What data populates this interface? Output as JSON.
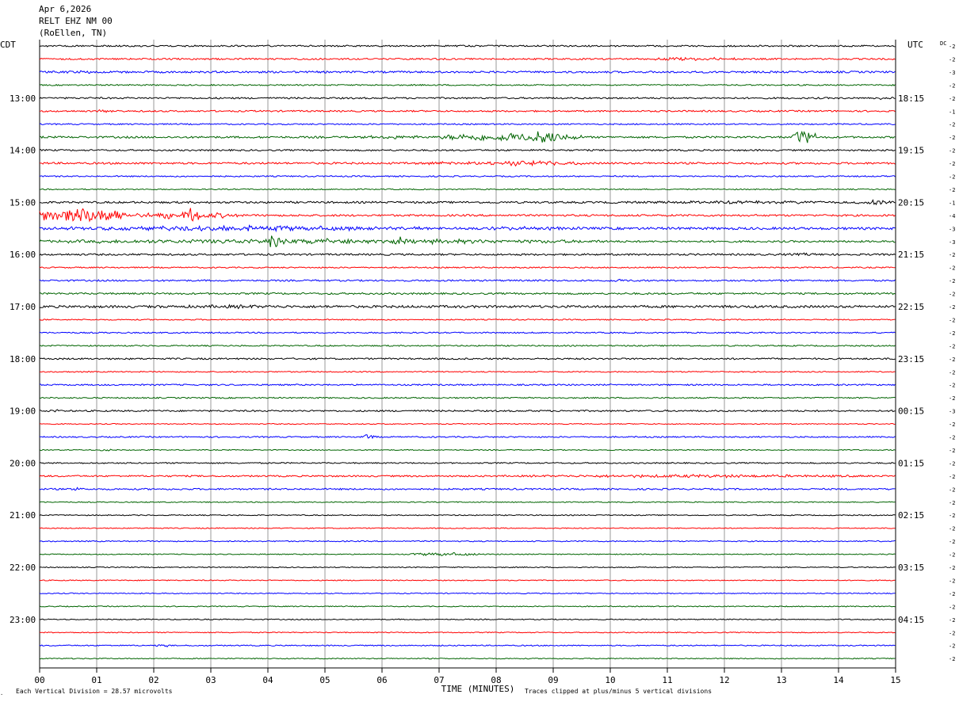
{
  "header": {
    "date": "Apr 6,2026",
    "station": "RELT EHZ NM 00",
    "location": "(RoEllen, TN)"
  },
  "left_zone": "CDT",
  "right_zone": "UTC",
  "dc_label": "DC",
  "footer": {
    "vertical_division": "Each Vertical Division =   28.57 microvolts",
    "clip_note": "Traces clipped at plus/minus 5 vertical divisions"
  },
  "chart_data": {
    "type": "line",
    "title": "",
    "xlabel": "TIME (MINUTES)",
    "ylabel": "",
    "xlim": [
      0,
      15
    ],
    "x_ticks": [
      "00",
      "01",
      "02",
      "03",
      "04",
      "05",
      "06",
      "07",
      "08",
      "09",
      "10",
      "11",
      "12",
      "13",
      "14",
      "15"
    ],
    "grid": true,
    "trace_colors": [
      "#000000",
      "#ff0000",
      "#0000ff",
      "#006400"
    ],
    "left_hour_labels": [
      "13:00",
      "14:00",
      "15:00",
      "16:00",
      "17:00",
      "18:00",
      "19:00",
      "20:00",
      "21:00",
      "22:00",
      "23:00"
    ],
    "right_hour_labels": [
      "18:15",
      "19:15",
      "20:15",
      "21:15",
      "22:15",
      "23:15",
      "00:15",
      "01:15",
      "02:15",
      "03:15",
      "04:15"
    ],
    "dc_offsets": [
      "-2",
      "-2",
      "-3",
      "-2",
      "-2",
      "-1",
      "-2",
      "-2",
      "-2",
      "-2",
      "-2",
      "-2",
      "-1",
      "-4",
      "-3",
      "-3",
      "-2",
      "-2",
      "-2",
      "-2",
      "-2",
      "-2",
      "-2",
      "-2",
      "-2",
      "-2",
      "-2",
      "-2",
      "-3",
      "-2",
      "-2",
      "-2",
      "-2",
      "-2",
      "-2",
      "-2",
      "-2",
      "-2",
      "-2",
      "-2",
      "-2",
      "-2",
      "-2",
      "-2",
      "-2",
      "-2",
      "-2",
      "-2"
    ],
    "traces": [
      {
        "amp": 1.0,
        "events": []
      },
      {
        "amp": 1.0,
        "events": [
          [
            10.5,
            12.5,
            1.8
          ]
        ]
      },
      {
        "amp": 1.2,
        "events": [
          [
            0,
            1.5,
            1.6
          ]
        ]
      },
      {
        "amp": 0.8,
        "events": []
      },
      {
        "amp": 1.0,
        "events": [
          [
            14.5,
            15,
            1.8
          ]
        ]
      },
      {
        "amp": 1.0,
        "events": [
          [
            0.9,
            1.5,
            1.6
          ]
        ]
      },
      {
        "amp": 0.8,
        "events": []
      },
      {
        "amp": 1.2,
        "events": [
          [
            5.5,
            7,
            2
          ],
          [
            7,
            9.5,
            5
          ],
          [
            8.6,
            9.1,
            10
          ],
          [
            13.2,
            13.6,
            8
          ]
        ]
      },
      {
        "amp": 1.0,
        "events": []
      },
      {
        "amp": 1.2,
        "events": [
          [
            6.5,
            7.5,
            2
          ],
          [
            7.5,
            9.5,
            3
          ]
        ]
      },
      {
        "amp": 0.8,
        "events": []
      },
      {
        "amp": 0.7,
        "events": []
      },
      {
        "amp": 1.2,
        "events": [
          [
            10,
            15,
            1.8
          ],
          [
            14.3,
            15,
            3
          ]
        ]
      },
      {
        "amp": 1.2,
        "events": [
          [
            0,
            1.5,
            10
          ],
          [
            1.5,
            3.5,
            4
          ],
          [
            2.5,
            2.8,
            8
          ]
        ]
      },
      {
        "amp": 1.5,
        "events": [
          [
            0,
            7,
            3
          ],
          [
            7,
            10,
            2
          ]
        ]
      },
      {
        "amp": 1.2,
        "events": [
          [
            0,
            10,
            3
          ],
          [
            4,
            4.2,
            8
          ],
          [
            6.2,
            6.4,
            7
          ]
        ]
      },
      {
        "amp": 1.1,
        "events": [
          [
            13,
            14,
            1.7
          ]
        ]
      },
      {
        "amp": 0.8,
        "events": []
      },
      {
        "amp": 1.0,
        "events": [
          [
            9.8,
            10.5,
            1.7
          ]
        ]
      },
      {
        "amp": 1.1,
        "events": []
      },
      {
        "amp": 1.5,
        "events": [
          [
            2,
            5,
            2
          ]
        ]
      },
      {
        "amp": 0.7,
        "events": []
      },
      {
        "amp": 0.8,
        "events": []
      },
      {
        "amp": 0.8,
        "events": []
      },
      {
        "amp": 1.0,
        "events": []
      },
      {
        "amp": 0.7,
        "events": []
      },
      {
        "amp": 0.9,
        "events": []
      },
      {
        "amp": 0.8,
        "events": []
      },
      {
        "amp": 1.0,
        "events": [
          [
            0,
            0.5,
            1.8
          ]
        ]
      },
      {
        "amp": 0.6,
        "events": []
      },
      {
        "amp": 0.8,
        "events": [
          [
            5.6,
            5.9,
            2.5
          ]
        ]
      },
      {
        "amp": 0.6,
        "events": [
          [
            1,
            1.3,
            2
          ]
        ]
      },
      {
        "amp": 0.8,
        "events": []
      },
      {
        "amp": 1.0,
        "events": [
          [
            8,
            15,
            1.8
          ]
        ]
      },
      {
        "amp": 1.0,
        "events": [
          [
            0.5,
            0.8,
            1.8
          ]
        ]
      },
      {
        "amp": 0.6,
        "events": []
      },
      {
        "amp": 0.6,
        "events": []
      },
      {
        "amp": 0.6,
        "events": []
      },
      {
        "amp": 0.7,
        "events": []
      },
      {
        "amp": 0.6,
        "events": [
          [
            6.5,
            7.7,
            2
          ]
        ]
      },
      {
        "amp": 0.6,
        "events": []
      },
      {
        "amp": 0.6,
        "events": []
      },
      {
        "amp": 0.6,
        "events": []
      },
      {
        "amp": 0.6,
        "events": []
      },
      {
        "amp": 0.6,
        "events": []
      },
      {
        "amp": 0.6,
        "events": []
      },
      {
        "amp": 0.7,
        "events": [
          [
            2,
            2.3,
            1.8
          ]
        ]
      },
      {
        "amp": 0.6,
        "events": []
      }
    ]
  }
}
